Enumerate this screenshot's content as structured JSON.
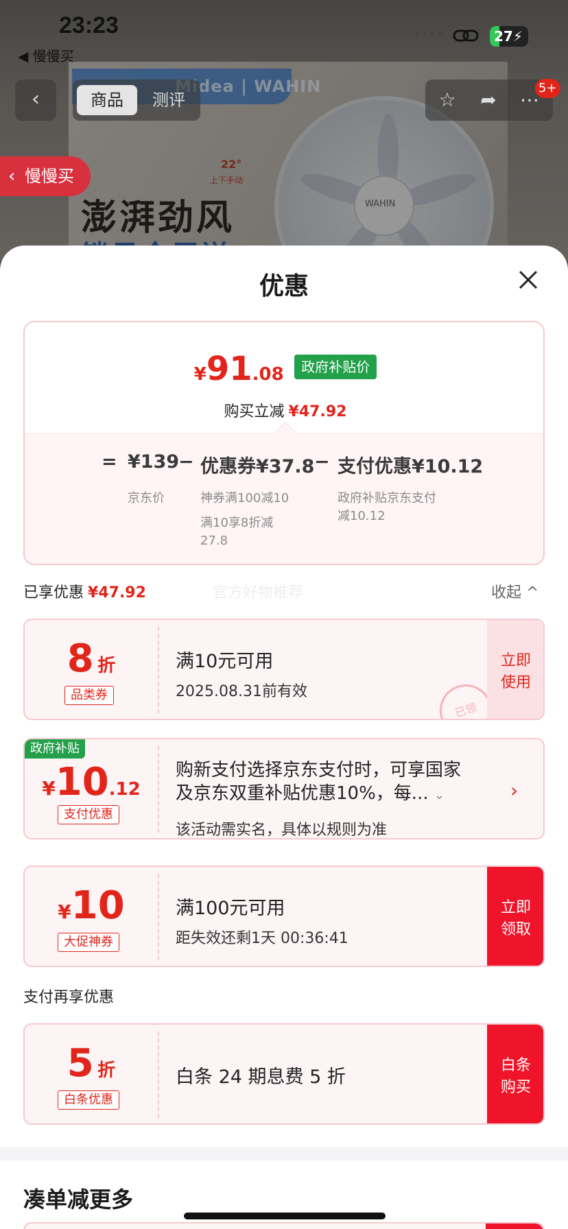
{
  "status_bar": {
    "time": "23:23",
    "back_app": "◀ 慢慢买",
    "battery": "27"
  },
  "product_bg": {
    "brand": "Midea | WAHIN",
    "angle": "22°",
    "angle_note": "上下手动",
    "headline": "澎湃劲风",
    "subheadline": "锁风全屋送",
    "fan_logo": "WAHIN"
  },
  "nav": {
    "tabs": [
      "商品",
      "测评"
    ],
    "cart_badge": "5+"
  },
  "floating": {
    "slow_buy": "慢慢买"
  },
  "sheet": {
    "title": "优惠",
    "summary": {
      "currency": "¥",
      "price_int": "91",
      "price_dec": ".08",
      "price_tag": "政府补贴价",
      "reduce_label": "购买立减",
      "reduce_amount": "¥47.92",
      "equation": {
        "eq": "=",
        "minus": "−",
        "jd_price": "¥139",
        "jd_label": "京东价",
        "coupon": "优惠券¥37.8",
        "coupon_detail_1": "神券满100减10",
        "coupon_detail_2": "满10享8折减",
        "coupon_detail_3": "27.8",
        "pay": "支付优惠¥10.12",
        "pay_detail_1": "政府补贴京东支付",
        "pay_detail_2": "减10.12"
      }
    },
    "enjoyed_label": "已享优惠",
    "enjoyed_amount": "¥47.92",
    "watermark": "官方好物推荐",
    "collapse_label": "收起 ^",
    "coupons": [
      {
        "big": "8",
        "unit": "折",
        "tag": "品类券",
        "line1": "满10元可用",
        "line2": "2025.08.31前有效",
        "action_1": "立即",
        "action_2": "使用",
        "stamp": "已领"
      },
      {
        "corner": "政府补贴",
        "cur": "¥",
        "big": "10",
        "small": ".12",
        "tag": "支付优惠",
        "line1": "购新支付选择京东支付时，可享国家",
        "line1b": "及京东双重补贴优惠10%，每...",
        "line2": "该活动需实名，具体以规则为准"
      },
      {
        "cur": "¥",
        "big": "10",
        "tag": "大促神券",
        "line1": "满100元可用",
        "line2": "距失效还剩1天 00:36:41",
        "action_1": "立即",
        "action_2": "领取"
      }
    ],
    "pay_section_label": "支付再享优惠",
    "baitiao": {
      "big": "5",
      "unit": "折",
      "tag": "白条优惠",
      "line1": "白条 24 期息费 5 折",
      "action_1": "白条",
      "action_2": "购买"
    },
    "more_title": "凑单减更多"
  },
  "colors": {
    "accent": "#e1251b",
    "gov_green": "#22a04a",
    "cta_red": "#f0142a"
  }
}
